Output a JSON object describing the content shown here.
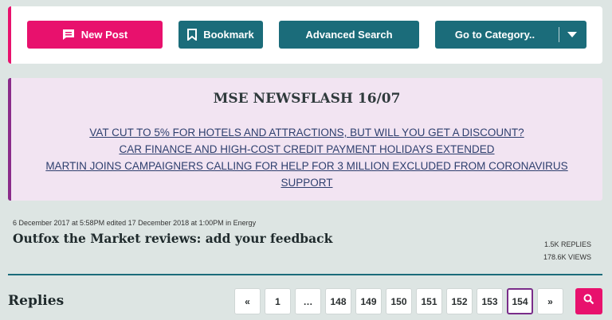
{
  "toolbar": {
    "new_post": "New Post",
    "bookmark": "Bookmark",
    "advanced_search": "Advanced Search",
    "go_to_category": "Go to Category.."
  },
  "newsflash": {
    "title": "MSE NEWSFLASH 16/07",
    "links": [
      "VAT CUT TO 5% FOR HOTELS AND ATTRACTIONS, BUT WILL YOU GET A DISCOUNT?",
      "CAR FINANCE AND HIGH-COST CREDIT PAYMENT HOLIDAYS EXTENDED",
      "MARTIN JOINS CAMPAIGNERS CALLING FOR HELP FOR 3 MILLION EXCLUDED FROM CORONAVIRUS SUPPORT"
    ]
  },
  "thread": {
    "meta": "6 December 2017 at 5:58PM edited 17 December 2018 at 1:00PM in Energy",
    "title": "Outfox the Market reviews: add your feedback",
    "replies": "1.5K REPLIES",
    "views": "178.6K VIEWS"
  },
  "replies_section": {
    "label": "Replies",
    "pages": [
      "«",
      "1",
      "…",
      "148",
      "149",
      "150",
      "151",
      "152",
      "153",
      "154",
      "»"
    ],
    "current_page": "154"
  },
  "colors": {
    "accent": "#e8116d",
    "teal": "#1b6c7a",
    "purple": "#8a2b8a"
  }
}
